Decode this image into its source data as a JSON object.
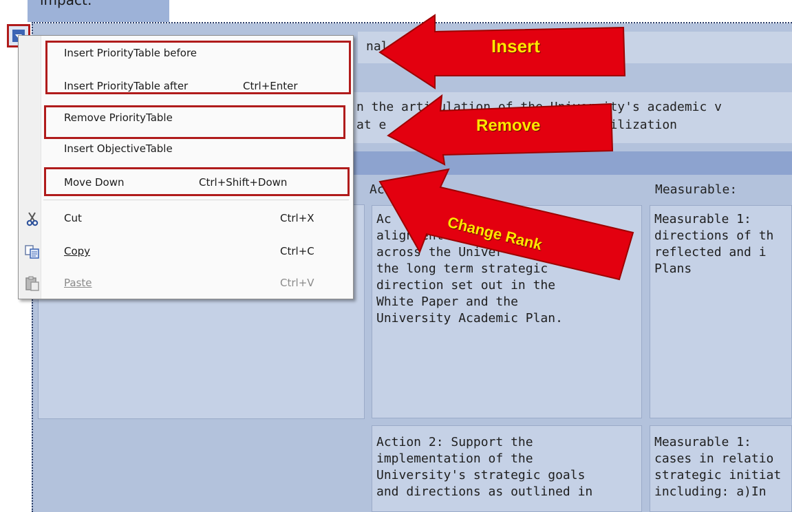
{
  "document": {
    "tab_partial_text": "impact:",
    "header_partial": "nal L",
    "intro_line_1": "n the articulation of the University's academic v",
    "intro_line_2": "at e                   tion and utilization",
    "column_action": "Actio",
    "column_measurable": "Measurable:",
    "row1_action": "Ac\nalignment\nacross the Univer\nthe long term strategic\ndirection set out in the\nWhite Paper and the\nUniversity Academic Plan.",
    "row1_measurable": "Measurable 1:\ndirections of th\nreflected and i\nPlans",
    "row2_action": "Action 2: Support the\nimplementation of the\nUniversity's strategic goals\nand directions as outlined in",
    "row2_measurable": "Measurable 1:\ncases in relatio\nstrategic initiat\nincluding: a)In"
  },
  "context_menu": {
    "items": [
      {
        "label": "Insert PriorityTable before",
        "shortcut": ""
      },
      {
        "label": "Insert PriorityTable after",
        "shortcut": "Ctrl+Enter"
      },
      {
        "label": "Remove PriorityTable",
        "shortcut": ""
      },
      {
        "label": "Insert ObjectiveTable",
        "shortcut": ""
      },
      {
        "label": "Move Down",
        "shortcut": "Ctrl+Shift+Down"
      }
    ],
    "clipboard": [
      {
        "label": "Cut",
        "shortcut": "Ctrl+X",
        "icon": "scissors-icon",
        "enabled": true
      },
      {
        "label": "Copy",
        "shortcut": "Ctrl+C",
        "icon": "copy-icon",
        "enabled": true
      },
      {
        "label": "Paste",
        "shortcut": "Ctrl+V",
        "icon": "paste-icon",
        "enabled": false
      }
    ]
  },
  "annotations": {
    "insert_label": "Insert",
    "remove_label": "Remove",
    "change_rank_label": "Change Rank",
    "highlight_color": "#b01b1b",
    "arrow_color": "#e3000f",
    "label_color": "#ffe600"
  }
}
